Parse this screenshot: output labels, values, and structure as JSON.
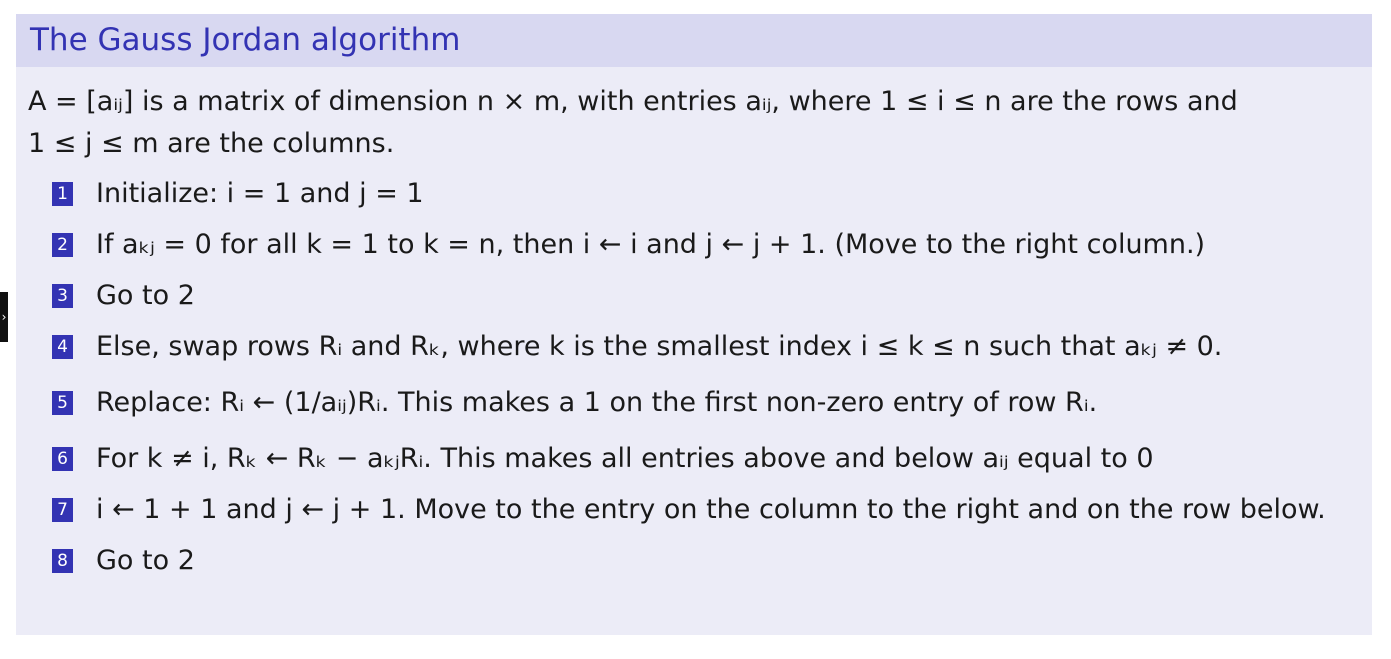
{
  "side_tab": {
    "glyph": "›"
  },
  "block": {
    "title": "The Gauss Jordan algorithm",
    "intro_line1": "A = [aᵢⱼ] is a matrix of dimension n × m, with entries aᵢⱼ, where 1 ≤ i ≤ n are the rows and",
    "intro_line2": "1 ≤ j ≤ m are the columns."
  },
  "steps": [
    {
      "number": "1",
      "text": "Initialize:  i = 1 and j = 1"
    },
    {
      "number": "2",
      "text": "If aₖⱼ = 0 for all k = 1 to k = n, then i ← i and j ← j + 1. (Move to the right column.)"
    },
    {
      "number": "3",
      "text": "Go to 2"
    },
    {
      "number": "4",
      "text": "Else, swap rows Rᵢ and Rₖ, where k is the smallest index i ≤ k ≤ n such that aₖⱼ ≠ 0."
    },
    {
      "number": "5",
      "text": "Replace:  Rᵢ ← (1/aᵢⱼ)Rᵢ. This makes a 1 on the first non-zero entry of row Rᵢ."
    },
    {
      "number": "6",
      "text": "For k ≠ i, Rₖ ← Rₖ − aₖⱼRᵢ. This makes all entries above and below aᵢⱼ equal to 0"
    },
    {
      "number": "7",
      "text": "i ← 1 + 1 and j ← j + 1. Move to the entry on the column to the right and on the row below."
    },
    {
      "number": "8",
      "text": "Go to 2"
    }
  ]
}
